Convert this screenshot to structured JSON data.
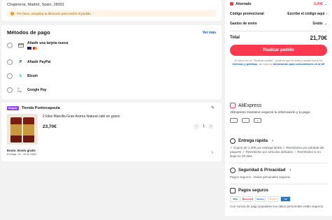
{
  "address": {
    "line": "Chapineria, Madrid, Spain, 28001",
    "warning": "Por favor, actualiza tu dirección para recibir el pedido"
  },
  "payment": {
    "title": "Métodos de pago",
    "see_more": "Ver más",
    "options": [
      {
        "label": "Añadir una tarjeta nueva",
        "icon": "card-icon"
      },
      {
        "label": "Añadir PayPal",
        "icon": "paypal-icon"
      },
      {
        "label": "Bizum",
        "icon": "bizum-icon"
      },
      {
        "label": "Google Pay",
        "icon": "gpay-icon"
      }
    ]
  },
  "store": {
    "badge": "Elegido",
    "name": "Tienda Puntocapsula",
    "product": {
      "title": "2 kilos Marcilla Gran Aroma Natural café en grano",
      "price": "23,70€",
      "quantity": "1"
    },
    "shipping": {
      "title": "Envío: Envío gratis",
      "delivery": "Entrega: 23 - 26 de MAR"
    }
  },
  "summary": {
    "saved_label": "Ahorrado",
    "saved_value": "-2,00€",
    "promo_label": "Código promocional",
    "promo_value": "Escribe el código aquí",
    "shipping_label": "Gastos de envío",
    "shipping_value": "Gratis",
    "total_label": "Total",
    "total_value": "21,70€",
    "cta": "Realizar pedido",
    "legal_1": "Al hacer clic en \"Realizar pedido\", confirmo que he leído y acepto todos los",
    "legal_link_1": "términos y políticas",
    "legal_2": ", así como la",
    "legal_link_2": "información para consumidores en la UE"
  },
  "aliexpress": {
    "name": "AliExpress",
    "text": "AliExpress mantiene seguros tu información y tu pago"
  },
  "delivery": {
    "title": "Entrega rápida",
    "text_1": "Cupón de 1,00€ por entrega tardía",
    "text_2": "Reembolso por pérdida del paquete",
    "text_3": "Reembolso por artículos dañados",
    "text_4": "Reembolso si no llega en 20 días"
  },
  "security": {
    "title": "Seguridad & Privacidad",
    "text": "Pagos seguros · Datos personales seguros"
  },
  "secure_payments": {
    "title": "Pagos seguros",
    "logos": [
      "VISA",
      "Mastercard",
      "SafeKey",
      "Protect",
      "AE"
    ],
    "text": "Con socios de pago populares tus datos personales están seguros"
  },
  "colors": {
    "accent": "#fd384f",
    "link": "#0a5bd3",
    "success": "#1d8a32"
  }
}
